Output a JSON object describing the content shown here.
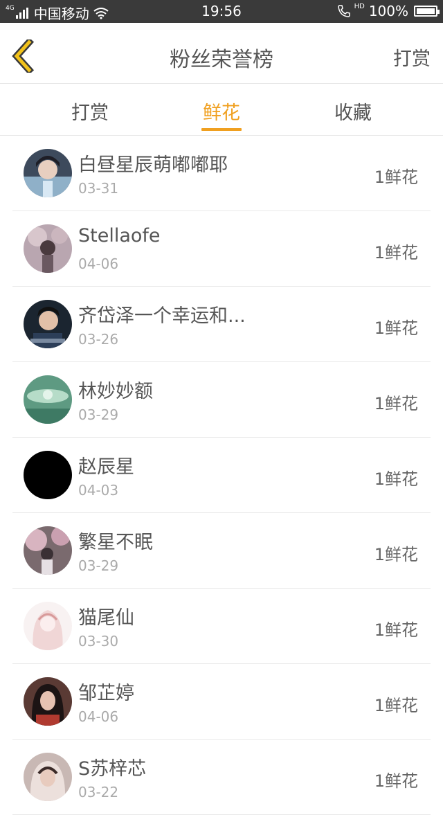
{
  "status_bar": {
    "network": "4G",
    "carrier": "中国移动",
    "time": "19:56",
    "hd": "HD",
    "battery": "100%"
  },
  "header": {
    "back_icon": "chevron-left-icon",
    "title": "粉丝荣誉榜",
    "reward": "打赏",
    "accent_color": "#f0a020"
  },
  "tabs": [
    {
      "label": "打赏",
      "active": false
    },
    {
      "label": "鲜花",
      "active": true
    },
    {
      "label": "收藏",
      "active": false
    }
  ],
  "fans": [
    {
      "name": "白昼星辰萌嘟嘟耶",
      "date": "03-31",
      "gift": "1鲜花"
    },
    {
      "name": "Stellaofe",
      "date": "04-06",
      "gift": "1鲜花"
    },
    {
      "name": "齐岱泽一个幸运和...",
      "date": "03-26",
      "gift": "1鲜花"
    },
    {
      "name": "林妙妙额",
      "date": "03-29",
      "gift": "1鲜花"
    },
    {
      "name": "赵辰星",
      "date": "04-03",
      "gift": "1鲜花"
    },
    {
      "name": "繁星不眠",
      "date": "03-29",
      "gift": "1鲜花"
    },
    {
      "name": "猫尾仙",
      "date": "03-30",
      "gift": "1鲜花"
    },
    {
      "name": "邹芷婷",
      "date": "04-06",
      "gift": "1鲜花"
    },
    {
      "name": "S苏梓芯",
      "date": "03-22",
      "gift": "1鲜花"
    }
  ]
}
